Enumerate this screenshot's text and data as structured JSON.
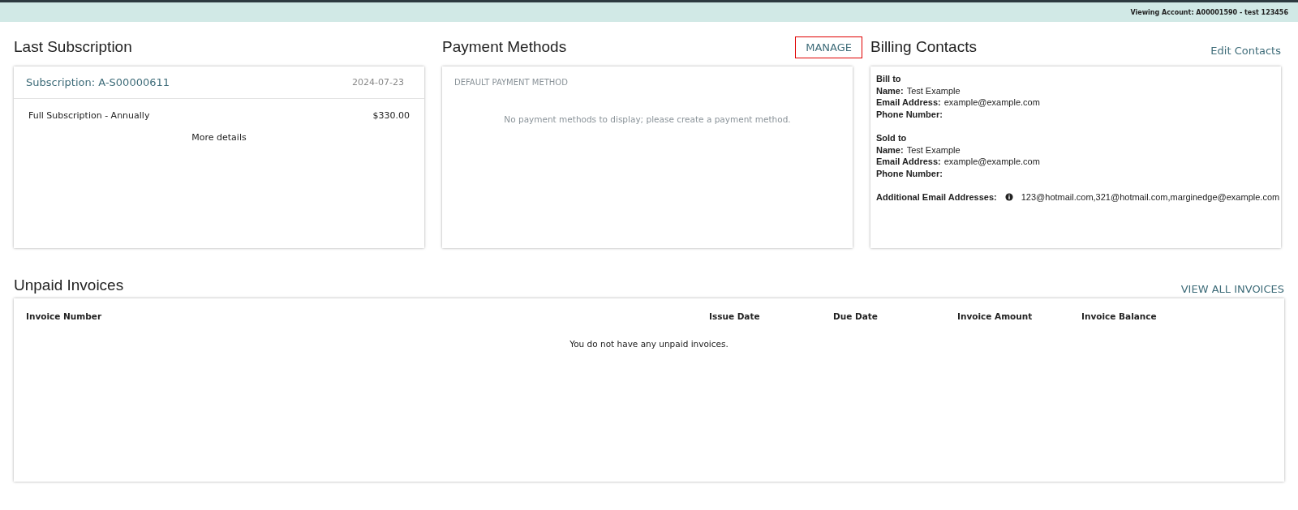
{
  "header": {
    "viewing_account": "Viewing Account: A00001590 - test 123456"
  },
  "last_subscription": {
    "title": "Last Subscription",
    "subscription_link": "Subscription: A-S00000611",
    "date": "2024-07-23",
    "items": [
      {
        "name": "Full Subscription - Annually",
        "price": "$330.00"
      }
    ],
    "more_details": "More details"
  },
  "payment_methods": {
    "title": "Payment Methods",
    "manage": {
      "label": "MANAGE",
      "highlighted": true
    },
    "section_label": "DEFAULT PAYMENT METHOD",
    "empty_message": "No payment methods to display; please create a payment method."
  },
  "billing_contacts": {
    "title": "Billing Contacts",
    "edit": "Edit Contacts",
    "groups": [
      {
        "heading": "Bill to",
        "fields": [
          {
            "label": "Name:",
            "value": "Test Example"
          },
          {
            "label": "Email Address:",
            "value": "example@example.com"
          },
          {
            "label": "Phone Number:"
          }
        ]
      },
      {
        "heading": "Sold to",
        "fields": [
          {
            "label": "Name:",
            "value": "Test Example"
          },
          {
            "label": "Email Address:",
            "value": "example@example.com"
          },
          {
            "label": "Phone Number:"
          }
        ]
      }
    ],
    "additional": {
      "label": "Additional Email Addresses:",
      "value": "123@hotmail.com,321@hotmail.com,marginedge@example.com"
    }
  },
  "unpaid_invoices": {
    "title": "Unpaid Invoices",
    "view_all": "VIEW ALL INVOICES",
    "columns": [
      "Invoice Number",
      "Issue Date",
      "Due Date",
      "Invoice Amount",
      "Invoice Balance"
    ],
    "empty_message": "You do not have any unpaid invoices."
  }
}
